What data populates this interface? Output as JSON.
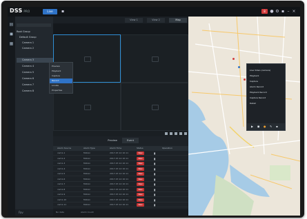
{
  "app": {
    "logo": "DSS",
    "logo_sub": "PRO",
    "live_tab": "Live"
  },
  "topbar": {
    "alarm_count": "8"
  },
  "tree": {
    "items": [
      "Root Group",
      "Default Group",
      "Camera 1",
      "Camera 2",
      "Camera 3",
      "Camera 4",
      "Camera 5",
      "Camera 6",
      "Camera 7",
      "Camera 8"
    ],
    "footer": "Fav"
  },
  "context_menu": {
    "items": [
      "Preview",
      "Playback",
      "Capture",
      "Record",
      "Locate",
      "Properties"
    ]
  },
  "video": {
    "tabs": [
      "View 1",
      "View 2",
      "Map"
    ]
  },
  "events": {
    "tabs": [
      "Preview",
      "Event"
    ],
    "columns": [
      "Alarm Source",
      "Alarm Type",
      "Alarm Time",
      "Status",
      "Operation"
    ],
    "rows": [
      {
        "source": "cam1-1",
        "type": "Motion",
        "time": "2017-07-12 10:11",
        "status": "New"
      },
      {
        "source": "cam1-2",
        "type": "Motion",
        "time": "2017-07-12 10:11",
        "status": "New"
      },
      {
        "source": "cam1-3",
        "type": "Motion",
        "time": "2017-07-12 10:11",
        "status": "New"
      },
      {
        "source": "cam1-4",
        "type": "Motion",
        "time": "2017-07-12 10:11",
        "status": "New"
      },
      {
        "source": "cam1-5",
        "type": "Motion",
        "time": "2017-07-12 10:11",
        "status": "New"
      },
      {
        "source": "cam1-6",
        "type": "Motion",
        "time": "2017-07-12 10:11",
        "status": "New"
      },
      {
        "source": "cam1-7",
        "type": "Motion",
        "time": "2017-07-12 10:11",
        "status": "New"
      },
      {
        "source": "cam1-8",
        "type": "Motion",
        "time": "2017-07-12 10:11",
        "status": "New"
      },
      {
        "source": "cam1-9",
        "type": "Motion",
        "time": "2017-07-12 10:11",
        "status": "New"
      },
      {
        "source": "cam1-10",
        "type": "Motion",
        "time": "2017-07-12 10:11",
        "status": "New"
      },
      {
        "source": "cam1-11",
        "type": "Motion",
        "time": "2017-07-12 10:11",
        "status": "New"
      }
    ],
    "footer_left": "No data",
    "footer_mid": "Alarm Count"
  },
  "map_menu": {
    "items": [
      "Live Video (camera)",
      "Playback",
      "Capture",
      "Alarm Record",
      "Playback Record",
      "Capture Record",
      "Detail"
    ]
  },
  "colors": {
    "accent": "#2f73c7",
    "alarm": "#c83232"
  },
  "icons": [
    "search-icon",
    "gear-icon",
    "camera-icon",
    "lock-icon",
    "close-icon"
  ]
}
